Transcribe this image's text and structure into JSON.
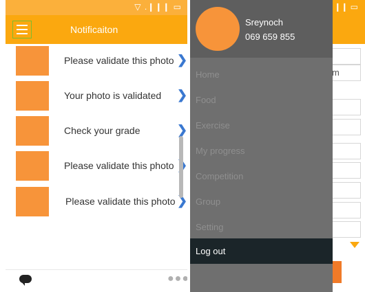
{
  "left_screen": {
    "status_icons": "▽ .❙❙❙ ▭",
    "menu_icon": "hamburger-menu-icon",
    "title": "Notificaiton",
    "notifications": [
      {
        "text": "Please validate this photo",
        "chevron": "❯"
      },
      {
        "text": "Your photo is validated",
        "chevron": "❯"
      },
      {
        "text": "Check your grade",
        "chevron": "❯"
      },
      {
        "text": "Please validate this photo",
        "chevron": "❯"
      },
      {
        "text": "Please validate this photo",
        "chevron": "❯"
      }
    ],
    "more_icon": "●●●"
  },
  "right_screen": {
    "status_icons": ".❙❙❙ ▭",
    "background_field_text": "m",
    "drawer": {
      "user_name": "Sreynoch",
      "user_phone": "069 659 855",
      "items": [
        "Home",
        "Food",
        "Exercise",
        "My progress",
        "Competition",
        "Group",
        "Setting"
      ],
      "logout_label": "Log out"
    }
  },
  "colors": {
    "app_bar": "#fba80f",
    "thumbnail": "#f7943a",
    "drawer_bg": "#6f6f6f",
    "logout_bg": "#1b2529",
    "chevron": "#3a78d0"
  }
}
